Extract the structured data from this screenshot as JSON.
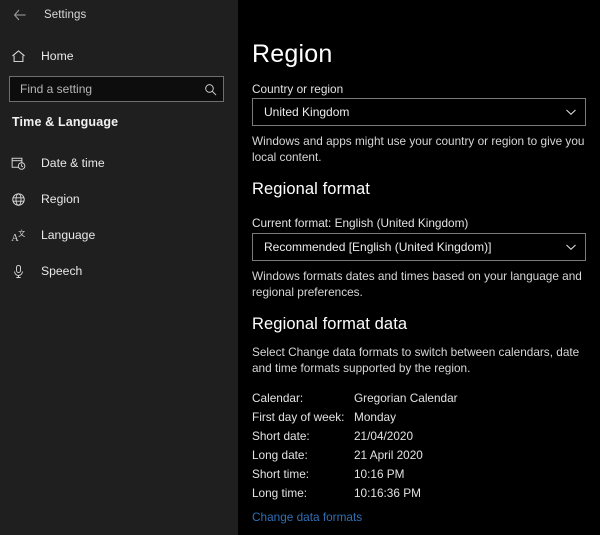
{
  "titlebar": {
    "back_icon": "back-arrow-icon",
    "title": "Settings"
  },
  "sidebar": {
    "home": {
      "label": "Home",
      "icon": "home-icon"
    },
    "search": {
      "placeholder": "Find a setting",
      "value": "",
      "icon": "search-icon"
    },
    "section_title": "Time & Language",
    "items": [
      {
        "label": "Date & time",
        "icon": "calendar-clock-icon"
      },
      {
        "label": "Region",
        "icon": "globe-icon"
      },
      {
        "label": "Language",
        "icon": "language-icon"
      },
      {
        "label": "Speech",
        "icon": "microphone-icon"
      }
    ]
  },
  "main": {
    "page_title": "Region",
    "country": {
      "label": "Country or region",
      "selected": "United Kingdom",
      "chevron_icon": "chevron-down-icon",
      "description": "Windows and apps might use your country or region to give you local content."
    },
    "regional_format": {
      "heading": "Regional format",
      "current_format": "Current format: English (United Kingdom)",
      "selected": "Recommended [English (United Kingdom)]",
      "chevron_icon": "chevron-down-icon",
      "description": "Windows formats dates and times based on your language and regional preferences."
    },
    "regional_format_data": {
      "heading": "Regional format data",
      "description": "Select Change data formats to switch between calendars, date and time formats supported by the region.",
      "rows": [
        {
          "key": "Calendar:",
          "value": "Gregorian Calendar"
        },
        {
          "key": "First day of week:",
          "value": "Monday"
        },
        {
          "key": "Short date:",
          "value": "21/04/2020"
        },
        {
          "key": "Long date:",
          "value": "21 April 2020"
        },
        {
          "key": "Short time:",
          "value": "10:16 PM"
        },
        {
          "key": "Long time:",
          "value": "10:16:36 PM"
        }
      ],
      "link_label": "Change data formats"
    }
  },
  "colors": {
    "sidebar_bg": "#1f1f1f",
    "content_bg": "#000000",
    "accent_link": "#2f6fb5",
    "text_primary": "#ffffff",
    "text_secondary": "#d6d6d6",
    "control_border": "#7a7a7a"
  }
}
